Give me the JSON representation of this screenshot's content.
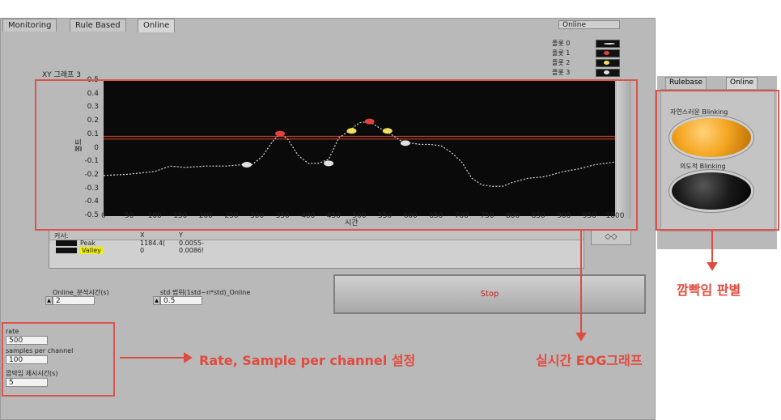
{
  "tabs": [
    {
      "label": "Monitoring"
    },
    {
      "label": "Rule Based"
    },
    {
      "label": "Online"
    }
  ],
  "online_indicator": "Online",
  "graph": {
    "title": "XY 그래프 3",
    "xlabel": "시간",
    "ylabel": "볼트",
    "legend": [
      {
        "label": "플롯 0"
      },
      {
        "label": "플롯 1"
      },
      {
        "label": "플롯 2"
      },
      {
        "label": "플롯 3"
      }
    ]
  },
  "cursor_table": {
    "headers": [
      "커서:",
      "X",
      "Y"
    ],
    "rows": [
      {
        "name": "Peak",
        "x": "1184.4(",
        "y": "0.0055-"
      },
      {
        "name": "Valley",
        "x": "0",
        "y": "0.0086!"
      }
    ]
  },
  "controls": {
    "analysis_time_label": "Online_분석시간(s)",
    "analysis_time_value": "2",
    "std_range_label": "std 범위(1std~n*std)_Online",
    "std_range_value": "0.5",
    "stop_label": "Stop",
    "rate_label": "rate",
    "rate_value": "500",
    "samples_label": "samples per channel",
    "samples_value": "100",
    "blink_time_label": "깜박임 제시시간(s)",
    "blink_time_value": "5"
  },
  "right_panel": {
    "tabs": [
      {
        "label": "Rulebase"
      },
      {
        "label": "Online"
      }
    ],
    "led1_label": "자연스러운 Blinking",
    "led2_label": "의도적 Blinking",
    "led1_color": "#f5a623",
    "led2_color": "#1a1a1a"
  },
  "annotations": {
    "rate_note": "Rate, Sample per channel 설정",
    "graph_note": "실시간 EOG그래프",
    "blink_note": "깜빡임 판별"
  },
  "chart_data": {
    "type": "line",
    "xlim": [
      0,
      1000
    ],
    "ylim": [
      -0.5,
      0.5
    ],
    "x_ticks": [
      0,
      50,
      100,
      150,
      200,
      250,
      300,
      350,
      400,
      450,
      500,
      550,
      600,
      650,
      700,
      750,
      800,
      850,
      900,
      950,
      1000
    ],
    "y_ticks": [
      0.5,
      0.4,
      0.3,
      0.2,
      0.1,
      0,
      -0.1,
      -0.2,
      -0.3,
      -0.4,
      -0.5
    ],
    "threshold_lines": [
      0.09,
      0.07
    ],
    "series": [
      {
        "x": [
          0,
          50,
          100,
          130,
          160,
          200,
          240,
          270,
          290,
          310,
          330,
          345,
          360,
          380,
          400,
          420,
          440,
          460,
          480,
          500,
          520,
          540,
          560,
          580,
          600,
          620,
          640,
          660,
          680,
          700,
          720,
          740,
          760,
          780,
          800,
          830,
          860,
          900,
          930,
          960,
          1000
        ],
        "y": [
          -0.2,
          -0.19,
          -0.17,
          -0.13,
          -0.14,
          -0.13,
          -0.13,
          -0.12,
          -0.12,
          -0.06,
          0.05,
          0.11,
          0.07,
          -0.05,
          -0.11,
          -0.11,
          -0.08,
          0.08,
          0.13,
          0.19,
          0.2,
          0.15,
          0.11,
          0.06,
          0.04,
          0.03,
          0.03,
          0.02,
          -0.03,
          -0.1,
          -0.22,
          -0.27,
          -0.28,
          -0.28,
          -0.25,
          -0.22,
          -0.21,
          -0.17,
          -0.15,
          -0.12,
          -0.1
        ]
      }
    ],
    "markers": [
      {
        "x": 280,
        "y": -0.12,
        "color": "#e0e0e0"
      },
      {
        "x": 345,
        "y": 0.11,
        "color": "#e04040"
      },
      {
        "x": 440,
        "y": -0.11,
        "color": "#e0e0e0"
      },
      {
        "x": 485,
        "y": 0.13,
        "color": "#f0e060"
      },
      {
        "x": 520,
        "y": 0.2,
        "color": "#e04040"
      },
      {
        "x": 555,
        "y": 0.13,
        "color": "#f0e060"
      },
      {
        "x": 590,
        "y": 0.04,
        "color": "#e0e0e0"
      }
    ]
  }
}
